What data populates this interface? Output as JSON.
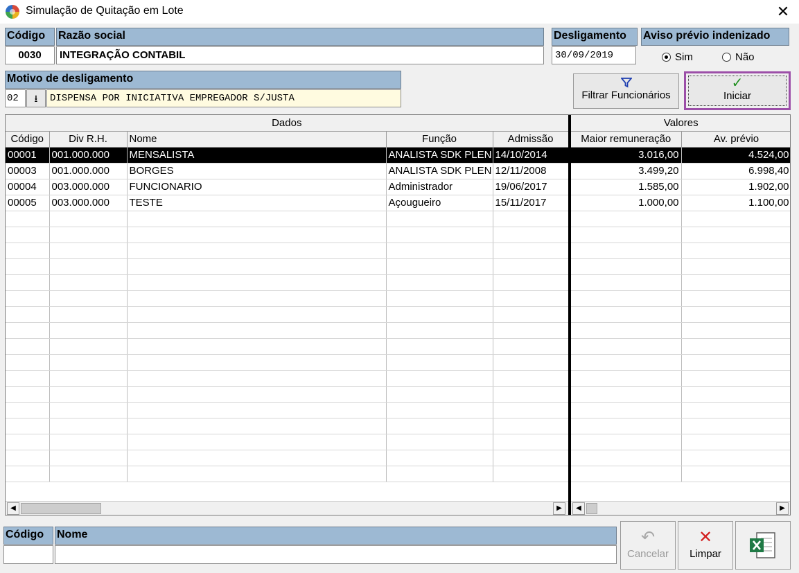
{
  "window": {
    "title": "Simulação de Quitação em Lote",
    "close_label": "✕"
  },
  "empresa": {
    "codigo_header": "Código",
    "codigo": "0030",
    "razao_header": "Razão social",
    "razao": "INTEGRAÇÃO CONTABIL"
  },
  "desligamento": {
    "header": "Desligamento",
    "date": "30/09/2019"
  },
  "aviso": {
    "header": "Aviso prévio indenizado",
    "sim": "Sim",
    "nao": "Não",
    "selected": "Sim"
  },
  "motivo": {
    "header": "Motivo de desligamento",
    "code": "02",
    "text": "DISPENSA POR INICIATIVA EMPREGADOR S/JUSTA"
  },
  "buttons": {
    "filtrar": "Filtrar Funcionários",
    "iniciar": "Iniciar",
    "cancelar": "Cancelar",
    "limpar": "Limpar"
  },
  "grid": {
    "group_dados": "Dados",
    "group_valores": "Valores",
    "columns": [
      "Código",
      "Div R.H.",
      "Nome",
      "Função",
      "Admissão",
      "Maior remuneração",
      "Av. prévio"
    ],
    "rows": [
      [
        "00001",
        "001.000.000",
        "MENSALISTA",
        "ANALISTA SDK PLEN",
        "14/10/2014",
        "3.016,00",
        "4.524,00"
      ],
      [
        "00003",
        "001.000.000",
        "BORGES",
        "ANALISTA SDK PLEN",
        "12/11/2008",
        "3.499,20",
        "6.998,40"
      ],
      [
        "00004",
        "003.000.000",
        "FUNCIONARIO",
        "Administrador",
        "19/06/2017",
        "1.585,00",
        "1.902,00"
      ],
      [
        "00005",
        "003.000.000",
        "TESTE",
        "Açougueiro",
        "15/11/2017",
        "1.000,00",
        "1.100,00"
      ]
    ],
    "selected_row": 0
  },
  "footer": {
    "codigo_header": "Código",
    "nome_header": "Nome",
    "codigo": "",
    "nome": ""
  },
  "colors": {
    "header_bg": "#9db9d3",
    "highlight_border": "#9c4fa8",
    "check": "#1e8f1e",
    "x": "#d32020",
    "filter": "#1f3fb0"
  }
}
